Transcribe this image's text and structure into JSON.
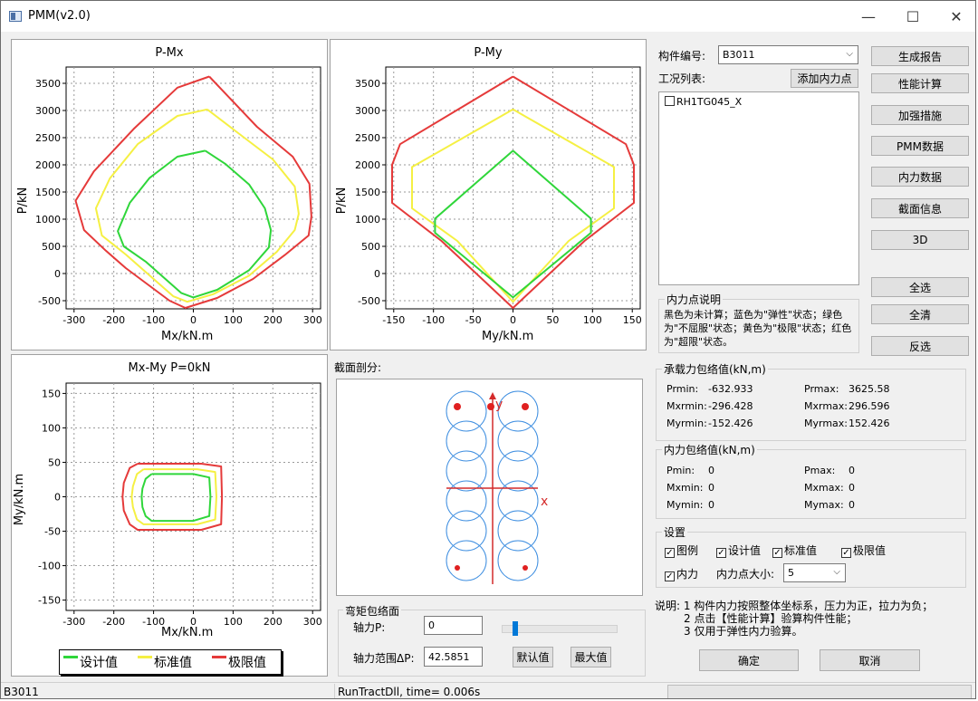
{
  "window": {
    "title": "PMM(v2.0)",
    "minimize": "—",
    "maximize": "☐",
    "close": "✕"
  },
  "charts": {
    "pmx": {
      "title": "P-Mx",
      "xlabel": "Mx/kN.m",
      "ylabel": "P/kN"
    },
    "pmy": {
      "title": "P-My",
      "xlabel": "My/kN.m",
      "ylabel": "P/kN"
    },
    "mxmy": {
      "title": "Mx-My P=0kN",
      "xlabel": "Mx/kN.m",
      "ylabel": "My/kN.m"
    }
  },
  "chart_data": [
    {
      "type": "line",
      "title": "P-Mx",
      "xlabel": "Mx/kN.m",
      "ylabel": "P/kN",
      "xlim": [
        -320,
        320
      ],
      "ylim": [
        -650,
        3800
      ],
      "xticks": [
        "-300",
        "-200",
        "-100",
        "0",
        "100",
        "200",
        "300"
      ],
      "yticks": [
        "-500",
        "0",
        "500",
        "1000",
        "1500",
        "2000",
        "2500",
        "3000",
        "3500"
      ],
      "grid": true,
      "series": [
        {
          "name": "极限值",
          "color": "#e53a3a",
          "points": [
            [
              40,
              3625
            ],
            [
              -40,
              3420
            ],
            [
              -150,
              2660
            ],
            [
              -250,
              1880
            ],
            [
              -296,
              1340
            ],
            [
              -275,
              800
            ],
            [
              -220,
              420
            ],
            [
              -170,
              100
            ],
            [
              -60,
              -500
            ],
            [
              -20,
              -633
            ],
            [
              60,
              -450
            ],
            [
              150,
              -100
            ],
            [
              230,
              340
            ],
            [
              290,
              700
            ],
            [
              297,
              1050
            ],
            [
              292,
              1650
            ],
            [
              250,
              2150
            ],
            [
              160,
              2700
            ],
            [
              40,
              3625
            ]
          ]
        },
        {
          "name": "标准值",
          "color": "#f5f043",
          "points": [
            [
              35,
              3020
            ],
            [
              -40,
              2900
            ],
            [
              -140,
              2380
            ],
            [
              -210,
              1750
            ],
            [
              -245,
              1200
            ],
            [
              -230,
              700
            ],
            [
              -170,
              350
            ],
            [
              -50,
              -420
            ],
            [
              -15,
              -520
            ],
            [
              50,
              -380
            ],
            [
              140,
              -40
            ],
            [
              210,
              400
            ],
            [
              255,
              800
            ],
            [
              265,
              1100
            ],
            [
              255,
              1600
            ],
            [
              200,
              2100
            ],
            [
              110,
              2600
            ],
            [
              35,
              3020
            ]
          ]
        },
        {
          "name": "设计值",
          "color": "#2fd63a",
          "points": [
            [
              30,
              2260
            ],
            [
              -40,
              2150
            ],
            [
              -110,
              1760
            ],
            [
              -160,
              1300
            ],
            [
              -190,
              780
            ],
            [
              -175,
              500
            ],
            [
              -120,
              220
            ],
            [
              -30,
              -360
            ],
            [
              0,
              -440
            ],
            [
              60,
              -300
            ],
            [
              140,
              60
            ],
            [
              190,
              480
            ],
            [
              195,
              800
            ],
            [
              180,
              1200
            ],
            [
              140,
              1640
            ],
            [
              80,
              2020
            ],
            [
              30,
              2260
            ]
          ]
        }
      ]
    },
    {
      "type": "line",
      "title": "P-My",
      "xlabel": "My/kN.m",
      "ylabel": "P/kN",
      "xlim": [
        -160,
        160
      ],
      "ylim": [
        -650,
        3800
      ],
      "xticks": [
        "-150",
        "-100",
        "-50",
        "0",
        "50",
        "100",
        "150"
      ],
      "yticks": [
        "-500",
        "0",
        "500",
        "1000",
        "1500",
        "2000",
        "2500",
        "3000",
        "3500"
      ],
      "grid": true,
      "series": [
        {
          "name": "极限值",
          "color": "#e53a3a",
          "points": [
            [
              0,
              3625
            ],
            [
              -142,
              2380
            ],
            [
              -152,
              2000
            ],
            [
              -152,
              1300
            ],
            [
              -90,
              600
            ],
            [
              0,
              -633
            ],
            [
              90,
              600
            ],
            [
              152,
              1300
            ],
            [
              152,
              2000
            ],
            [
              142,
              2380
            ],
            [
              0,
              3625
            ]
          ]
        },
        {
          "name": "标准值",
          "color": "#f5f043",
          "points": [
            [
              0,
              3020
            ],
            [
              -127,
              1960
            ],
            [
              -127,
              1200
            ],
            [
              -70,
              600
            ],
            [
              0,
              -520
            ],
            [
              70,
              600
            ],
            [
              127,
              1200
            ],
            [
              127,
              1960
            ],
            [
              0,
              3020
            ]
          ]
        },
        {
          "name": "设计值",
          "color": "#2fd63a",
          "points": [
            [
              0,
              2260
            ],
            [
              -98,
              1010
            ],
            [
              -98,
              750
            ],
            [
              0,
              -440
            ],
            [
              98,
              750
            ],
            [
              98,
              1010
            ],
            [
              0,
              2260
            ]
          ]
        }
      ]
    },
    {
      "type": "line",
      "title": "Mx-My P=0kN",
      "xlabel": "Mx/kN.m",
      "ylabel": "My/kN.m",
      "xlim": [
        -320,
        320
      ],
      "ylim": [
        -165,
        165
      ],
      "xticks": [
        "-300",
        "-200",
        "-100",
        "0",
        "100",
        "200",
        "300"
      ],
      "yticks": [
        "-150",
        "-100",
        "-50",
        "0",
        "50",
        "100",
        "150"
      ],
      "grid": true,
      "legend": "bottom",
      "series": [
        {
          "name": "极限值",
          "color": "#e53a3a",
          "points": [
            [
              -140,
              48
            ],
            [
              -160,
              42
            ],
            [
              -175,
              20
            ],
            [
              -178,
              0
            ],
            [
              -175,
              -20
            ],
            [
              -160,
              -40
            ],
            [
              -140,
              -48
            ],
            [
              20,
              -48
            ],
            [
              70,
              -40
            ],
            [
              72,
              0
            ],
            [
              70,
              44
            ],
            [
              20,
              48
            ],
            [
              -140,
              48
            ]
          ]
        },
        {
          "name": "标准值",
          "color": "#f5f043",
          "points": [
            [
              -125,
              40
            ],
            [
              -142,
              33
            ],
            [
              -152,
              15
            ],
            [
              -155,
              0
            ],
            [
              -152,
              -15
            ],
            [
              -142,
              -33
            ],
            [
              -125,
              -40
            ],
            [
              10,
              -40
            ],
            [
              55,
              -33
            ],
            [
              58,
              0
            ],
            [
              55,
              36
            ],
            [
              10,
              40
            ],
            [
              -125,
              40
            ]
          ]
        },
        {
          "name": "设计值",
          "color": "#2fd63a",
          "points": [
            [
              -105,
              33
            ],
            [
              -120,
              26
            ],
            [
              -128,
              12
            ],
            [
              -130,
              0
            ],
            [
              -128,
              -15
            ],
            [
              -120,
              -28
            ],
            [
              -105,
              -35
            ],
            [
              0,
              -35
            ],
            [
              40,
              -28
            ],
            [
              43,
              0
            ],
            [
              40,
              28
            ],
            [
              0,
              33
            ],
            [
              -105,
              33
            ]
          ]
        }
      ]
    }
  ],
  "legend": {
    "items": [
      {
        "label": "设计值",
        "color": "#2fd63a"
      },
      {
        "label": "标准值",
        "color": "#f5f043"
      },
      {
        "label": "极限值",
        "color": "#e53a3a"
      }
    ]
  },
  "section": {
    "title": "截面剖分:",
    "axis_y": "y",
    "axis_x": "x"
  },
  "bending_envelope": {
    "title": "弯矩包络面",
    "axial_label": "轴力P:",
    "axial_value": "0",
    "slider_level": 0.12,
    "range_label": "轴力范围ΔP:",
    "range_value": "42.5851",
    "default_button": "默认值",
    "max_button": "最大值"
  },
  "right": {
    "member_label": "构件编号:",
    "member_value": "B3011",
    "cases_label": "工况列表:",
    "add_point_button": "添加内力点",
    "cases": [
      {
        "label": "RH1TG045_X",
        "checked": false
      }
    ],
    "desc_title": "内力点说明",
    "desc_text": "黑色为未计算；蓝色为\"弹性\"状态；绿色为\"不屈服\"状态；黄色为\"极限\"状态；红色为\"超限\"状态。",
    "capacity_title": "承载力包络值(kN,m)",
    "capacity": [
      {
        "label": "Prmin:",
        "value": "-632.933"
      },
      {
        "label": "Prmax:",
        "value": "3625.58"
      },
      {
        "label": "Mxrmin:",
        "value": "-296.428"
      },
      {
        "label": "Mxrmax:",
        "value": "296.596"
      },
      {
        "label": "Myrmin:",
        "value": "-152.426"
      },
      {
        "label": "Myrmax:",
        "value": "152.426"
      }
    ],
    "force_title": "内力包络值(kN,m)",
    "force": [
      {
        "label": "Pmin:",
        "value": "0"
      },
      {
        "label": "Pmax:",
        "value": "0"
      },
      {
        "label": "Mxmin:",
        "value": "0"
      },
      {
        "label": "Mxmax:",
        "value": "0"
      },
      {
        "label": "Mymin:",
        "value": "0"
      },
      {
        "label": "Mymax:",
        "value": "0"
      }
    ],
    "settings_title": "设置",
    "settings": [
      {
        "label": "图例",
        "checked": true
      },
      {
        "label": "设计值",
        "checked": true
      },
      {
        "label": "标准值",
        "checked": true
      },
      {
        "label": "极限值",
        "checked": true
      },
      {
        "label": "内力",
        "checked": true
      }
    ],
    "point_size_label": "内力点大小:",
    "point_size_value": "5",
    "note_lines": [
      "说明: 1 构件内力按照整体坐标系，压力为正，拉力为负；",
      "2 点击【性能计算】验算构件性能；",
      "3 仅用于弹性内力验算。"
    ],
    "ok_button": "确定",
    "cancel_button": "取消"
  },
  "side_buttons": [
    "生成报告",
    "性能计算",
    "加强措施",
    "PMM数据",
    "内力数据",
    "截面信息",
    "3D",
    "全选",
    "全清",
    "反选"
  ],
  "status": {
    "left": "B3011",
    "middle": "RunTractDll, time= 0.006s"
  }
}
